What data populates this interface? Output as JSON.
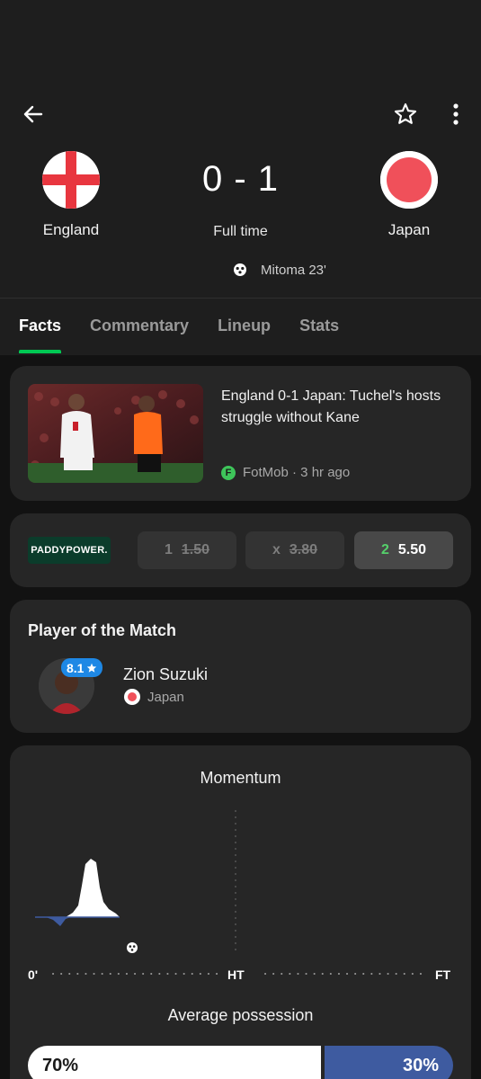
{
  "match": {
    "home": {
      "name": "England",
      "flag": "england-flag-icon"
    },
    "away": {
      "name": "Japan",
      "flag": "japan-flag-icon"
    },
    "score": "0 - 1",
    "status": "Full time",
    "scorer": "Mitoma 23'"
  },
  "tabs": [
    {
      "label": "Facts",
      "active": true
    },
    {
      "label": "Commentary",
      "active": false
    },
    {
      "label": "Lineup",
      "active": false
    },
    {
      "label": "Stats",
      "active": false
    }
  ],
  "news": {
    "title": "England 0-1 Japan: Tuchel's hosts struggle without Kane",
    "source": "FotMob · 3 hr ago"
  },
  "odds": {
    "bookmaker": "PADDYPOWER.",
    "options": [
      {
        "label": "1",
        "value": "1.50"
      },
      {
        "label": "x",
        "value": "3.80"
      },
      {
        "label": "2",
        "value": "5.50"
      }
    ]
  },
  "potm": {
    "title": "Player of the Match",
    "rating": "8.1",
    "player": "Zion Suzuki",
    "team": "Japan"
  },
  "momentum": {
    "title": "Momentum",
    "start": "0'",
    "half": "HT",
    "end": "FT"
  },
  "possession": {
    "title": "Average possession",
    "home": "70%",
    "away": "30%"
  },
  "colors": {
    "accent": "#00c853",
    "rating": "#1e88e5",
    "away_possession": "#3e5ba0",
    "japan_red": "#f0505a",
    "england_red": "#e8363f"
  }
}
